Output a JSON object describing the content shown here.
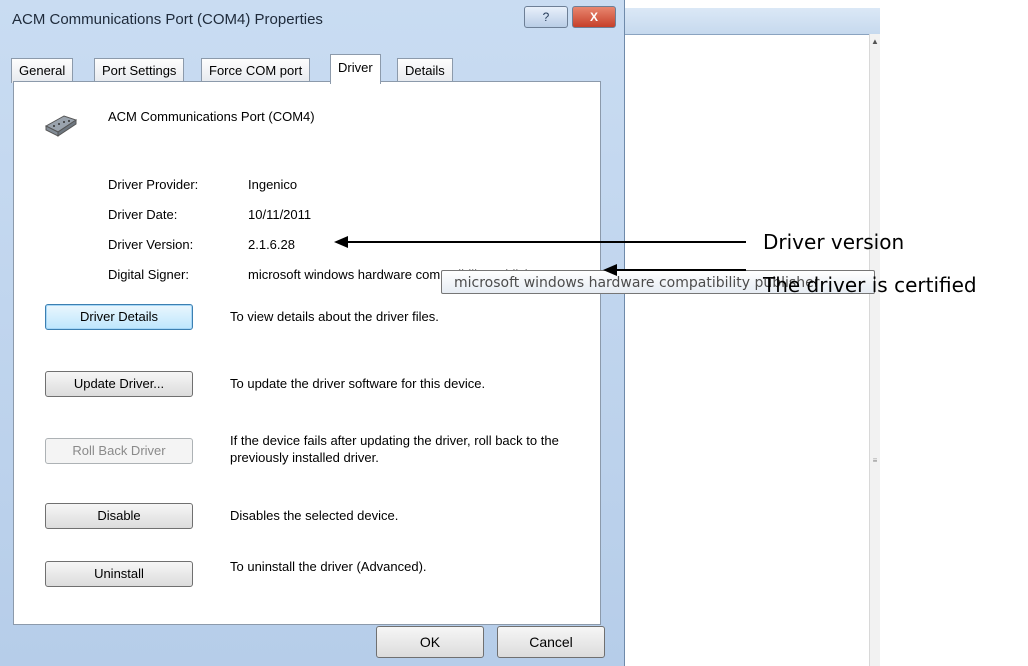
{
  "dialog": {
    "title": "ACM Communications Port (COM4) Properties",
    "help_label": "?",
    "close_label": "X",
    "tabs": [
      {
        "label": "General"
      },
      {
        "label": "Port Settings"
      },
      {
        "label": "Force COM port"
      },
      {
        "label": "Driver",
        "active": true
      },
      {
        "label": "Details"
      }
    ],
    "device_name": "ACM Communications Port (COM4)",
    "device_icon": "serial-port-icon",
    "fields": [
      {
        "label": "Driver Provider:",
        "value": "Ingenico"
      },
      {
        "label": "Driver Date:",
        "value": "10/11/2011"
      },
      {
        "label": "Driver Version:",
        "value": "2.1.6.28"
      },
      {
        "label": "Digital Signer:",
        "value": "microsoft windows hardware compatibility publisl"
      }
    ],
    "actions": [
      {
        "label": "Driver Details",
        "description": "To view details about the driver files."
      },
      {
        "label": "Update Driver...",
        "description": "To update the driver software for this device."
      },
      {
        "label": "Roll Back Driver",
        "description": "If the device fails after updating the driver, roll back to the previously installed driver."
      },
      {
        "label": "Disable",
        "description": "Disables the selected device."
      },
      {
        "label": "Uninstall",
        "description": "To uninstall the driver (Advanced)."
      }
    ],
    "ok_label": "OK",
    "cancel_label": "Cancel"
  },
  "tooltip": "microsoft windows hardware compatibility publisher",
  "annotations": {
    "version": "Driver version",
    "certified": "The driver is certified"
  }
}
